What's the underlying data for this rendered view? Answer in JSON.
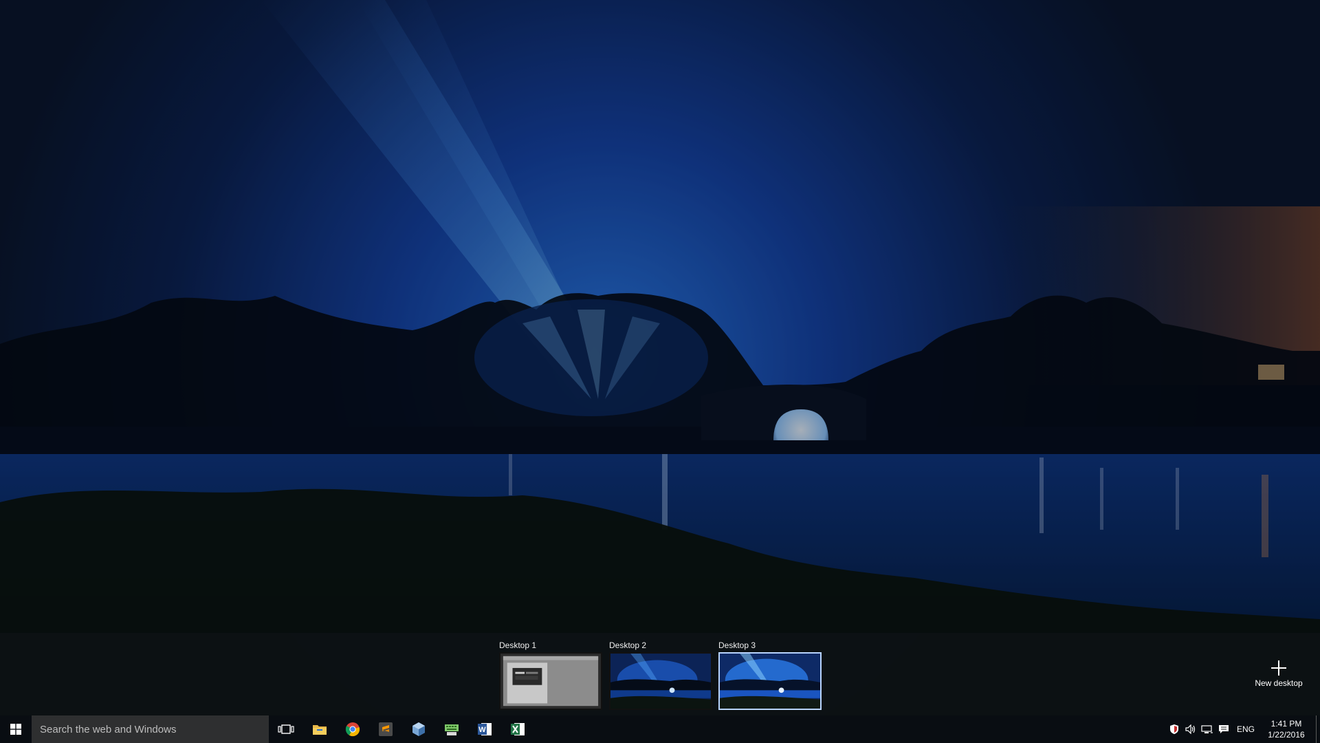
{
  "desktops": [
    {
      "label": "Desktop 1",
      "active": false,
      "kind": "window"
    },
    {
      "label": "Desktop 2",
      "active": false,
      "kind": "wallpaper"
    },
    {
      "label": "Desktop 3",
      "active": true,
      "kind": "wallpaper"
    }
  ],
  "new_desktop": {
    "label": "New desktop",
    "icon": "plus-icon"
  },
  "taskbar": {
    "start_icon": "windows-logo-icon",
    "search_placeholder": "Search the web and Windows",
    "task_view_icon": "task-view-icon",
    "pinned_apps": [
      {
        "name": "file-explorer",
        "icon": "folder-icon"
      },
      {
        "name": "chrome",
        "icon": "chrome-icon"
      },
      {
        "name": "sublime-text",
        "icon": "sublime-icon"
      },
      {
        "name": "virtualbox",
        "icon": "virtualbox-icon"
      },
      {
        "name": "keyboard-app",
        "icon": "keyboard-icon"
      },
      {
        "name": "word",
        "icon": "word-icon"
      },
      {
        "name": "excel",
        "icon": "excel-icon"
      }
    ]
  },
  "tray": {
    "language": "ENG",
    "time": "1:41 PM",
    "date": "1/22/2016",
    "icons": [
      "shield-icon",
      "volume-icon",
      "network-icon",
      "action-center-icon"
    ]
  },
  "colors": {
    "sky_top": "#0a1a35",
    "sky_glow": "#1f5fd0",
    "active_border": "#b8d4ff",
    "taskbar": "#0a0e14",
    "search_bg": "#2e2f30"
  }
}
